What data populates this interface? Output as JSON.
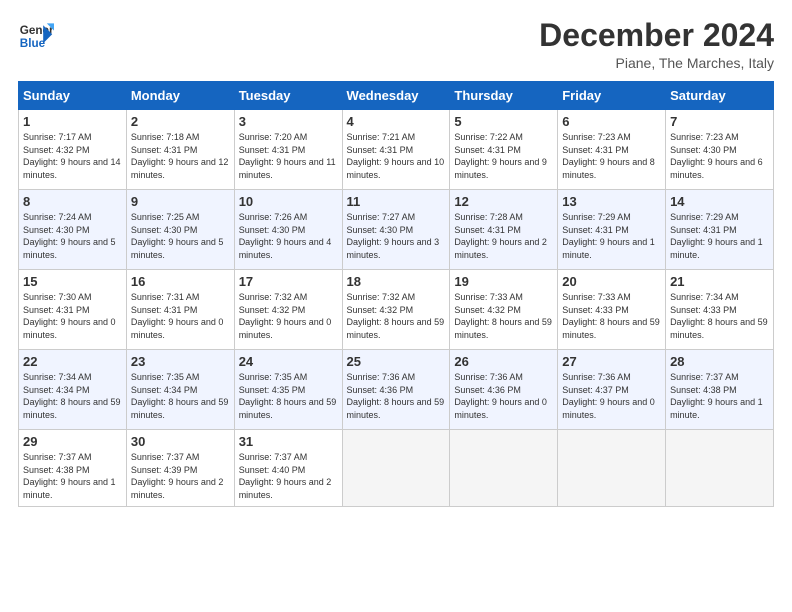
{
  "header": {
    "logo_line1": "General",
    "logo_line2": "Blue",
    "month": "December 2024",
    "location": "Piane, The Marches, Italy"
  },
  "days_of_week": [
    "Sunday",
    "Monday",
    "Tuesday",
    "Wednesday",
    "Thursday",
    "Friday",
    "Saturday"
  ],
  "weeks": [
    [
      {
        "day": "1",
        "sunrise": "7:17 AM",
        "sunset": "4:32 PM",
        "daylight": "9 hours and 14 minutes."
      },
      {
        "day": "2",
        "sunrise": "7:18 AM",
        "sunset": "4:31 PM",
        "daylight": "9 hours and 12 minutes."
      },
      {
        "day": "3",
        "sunrise": "7:20 AM",
        "sunset": "4:31 PM",
        "daylight": "9 hours and 11 minutes."
      },
      {
        "day": "4",
        "sunrise": "7:21 AM",
        "sunset": "4:31 PM",
        "daylight": "9 hours and 10 minutes."
      },
      {
        "day": "5",
        "sunrise": "7:22 AM",
        "sunset": "4:31 PM",
        "daylight": "9 hours and 9 minutes."
      },
      {
        "day": "6",
        "sunrise": "7:23 AM",
        "sunset": "4:31 PM",
        "daylight": "9 hours and 8 minutes."
      },
      {
        "day": "7",
        "sunrise": "7:23 AM",
        "sunset": "4:30 PM",
        "daylight": "9 hours and 6 minutes."
      }
    ],
    [
      {
        "day": "8",
        "sunrise": "7:24 AM",
        "sunset": "4:30 PM",
        "daylight": "9 hours and 5 minutes."
      },
      {
        "day": "9",
        "sunrise": "7:25 AM",
        "sunset": "4:30 PM",
        "daylight": "9 hours and 5 minutes."
      },
      {
        "day": "10",
        "sunrise": "7:26 AM",
        "sunset": "4:30 PM",
        "daylight": "9 hours and 4 minutes."
      },
      {
        "day": "11",
        "sunrise": "7:27 AM",
        "sunset": "4:30 PM",
        "daylight": "9 hours and 3 minutes."
      },
      {
        "day": "12",
        "sunrise": "7:28 AM",
        "sunset": "4:31 PM",
        "daylight": "9 hours and 2 minutes."
      },
      {
        "day": "13",
        "sunrise": "7:29 AM",
        "sunset": "4:31 PM",
        "daylight": "9 hours and 1 minute."
      },
      {
        "day": "14",
        "sunrise": "7:29 AM",
        "sunset": "4:31 PM",
        "daylight": "9 hours and 1 minute."
      }
    ],
    [
      {
        "day": "15",
        "sunrise": "7:30 AM",
        "sunset": "4:31 PM",
        "daylight": "9 hours and 0 minutes."
      },
      {
        "day": "16",
        "sunrise": "7:31 AM",
        "sunset": "4:31 PM",
        "daylight": "9 hours and 0 minutes."
      },
      {
        "day": "17",
        "sunrise": "7:32 AM",
        "sunset": "4:32 PM",
        "daylight": "9 hours and 0 minutes."
      },
      {
        "day": "18",
        "sunrise": "7:32 AM",
        "sunset": "4:32 PM",
        "daylight": "8 hours and 59 minutes."
      },
      {
        "day": "19",
        "sunrise": "7:33 AM",
        "sunset": "4:32 PM",
        "daylight": "8 hours and 59 minutes."
      },
      {
        "day": "20",
        "sunrise": "7:33 AM",
        "sunset": "4:33 PM",
        "daylight": "8 hours and 59 minutes."
      },
      {
        "day": "21",
        "sunrise": "7:34 AM",
        "sunset": "4:33 PM",
        "daylight": "8 hours and 59 minutes."
      }
    ],
    [
      {
        "day": "22",
        "sunrise": "7:34 AM",
        "sunset": "4:34 PM",
        "daylight": "8 hours and 59 minutes."
      },
      {
        "day": "23",
        "sunrise": "7:35 AM",
        "sunset": "4:34 PM",
        "daylight": "8 hours and 59 minutes."
      },
      {
        "day": "24",
        "sunrise": "7:35 AM",
        "sunset": "4:35 PM",
        "daylight": "8 hours and 59 minutes."
      },
      {
        "day": "25",
        "sunrise": "7:36 AM",
        "sunset": "4:36 PM",
        "daylight": "8 hours and 59 minutes."
      },
      {
        "day": "26",
        "sunrise": "7:36 AM",
        "sunset": "4:36 PM",
        "daylight": "9 hours and 0 minutes."
      },
      {
        "day": "27",
        "sunrise": "7:36 AM",
        "sunset": "4:37 PM",
        "daylight": "9 hours and 0 minutes."
      },
      {
        "day": "28",
        "sunrise": "7:37 AM",
        "sunset": "4:38 PM",
        "daylight": "9 hours and 1 minute."
      }
    ],
    [
      {
        "day": "29",
        "sunrise": "7:37 AM",
        "sunset": "4:38 PM",
        "daylight": "9 hours and 1 minute."
      },
      {
        "day": "30",
        "sunrise": "7:37 AM",
        "sunset": "4:39 PM",
        "daylight": "9 hours and 2 minutes."
      },
      {
        "day": "31",
        "sunrise": "7:37 AM",
        "sunset": "4:40 PM",
        "daylight": "9 hours and 2 minutes."
      },
      null,
      null,
      null,
      null
    ]
  ]
}
